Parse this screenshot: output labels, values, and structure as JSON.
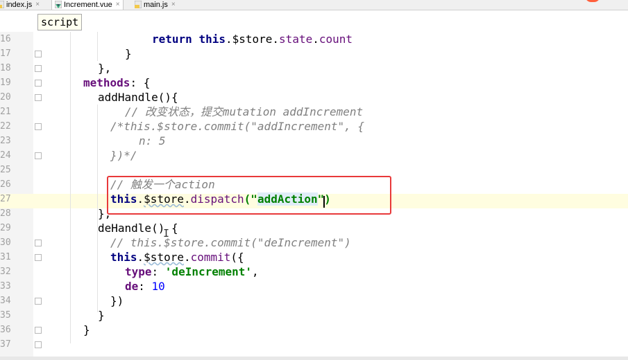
{
  "tabs": [
    {
      "label": "index.js",
      "icon": "js-file-icon"
    },
    {
      "label": "Increment.vue",
      "icon": "vue-file-icon"
    },
    {
      "label": "main.js",
      "icon": "js-file-icon"
    }
  ],
  "tab_close_glyph": "×",
  "breadcrumb": "script",
  "line_numbers": [
    "16",
    "17",
    "18",
    "19",
    "20",
    "21",
    "22",
    "23",
    "24",
    "25",
    "26",
    "27",
    "28",
    "29",
    "30",
    "31",
    "32",
    "33",
    "34",
    "35",
    "36",
    "37"
  ],
  "code": {
    "l16": {
      "kw_return": "return",
      "kw_this": "this",
      "dot1": ".",
      "store": "$store",
      "dot2": ".",
      "state": "state",
      "dot3": ".",
      "count": "count"
    },
    "l17": {
      "text": "}"
    },
    "l18": {
      "text": "},"
    },
    "l19": {
      "methods": "methods",
      "rest": ": {"
    },
    "l20": {
      "text": "addHandle(){"
    },
    "l21": {
      "comment": "// 改变状态，提交mutation addIncrement"
    },
    "l22": {
      "comment": "/*this.$store.commit(\"addIncrement\", {"
    },
    "l23": {
      "comment": "n: 5"
    },
    "l24": {
      "comment": "})*/"
    },
    "l26": {
      "comment": "// 触发一个action"
    },
    "l27": {
      "kw_this": "this",
      "dot1": ".",
      "store": "$store",
      "dot2": ".",
      "method": "dispatch",
      "open": "(\"",
      "arg": "addAction",
      "close": "\")"
    },
    "l28": {
      "text": "},"
    },
    "l29": {
      "text": "deHandle() {"
    },
    "l30": {
      "comment": "// this.$store.commit(\"deIncrement\")"
    },
    "l31": {
      "kw_this": "this",
      "dot1": ".",
      "store": "$store",
      "dot2": ".",
      "method": "commit",
      "rest": "({"
    },
    "l32": {
      "key": "type",
      "colon": ": ",
      "value": "'deIncrement'",
      "comma": ","
    },
    "l33": {
      "key": "de",
      "colon": ": ",
      "value": "10"
    },
    "l34": {
      "text": "})"
    },
    "l35": {
      "text": "}"
    },
    "l36": {
      "text": "}"
    }
  },
  "colors": {
    "keyword": "#000080",
    "property": "#660e7a",
    "comment": "#808080",
    "string": "#008000",
    "number": "#0000ff",
    "highlight_box": "#e8393a",
    "caret_line": "#fffde0"
  }
}
